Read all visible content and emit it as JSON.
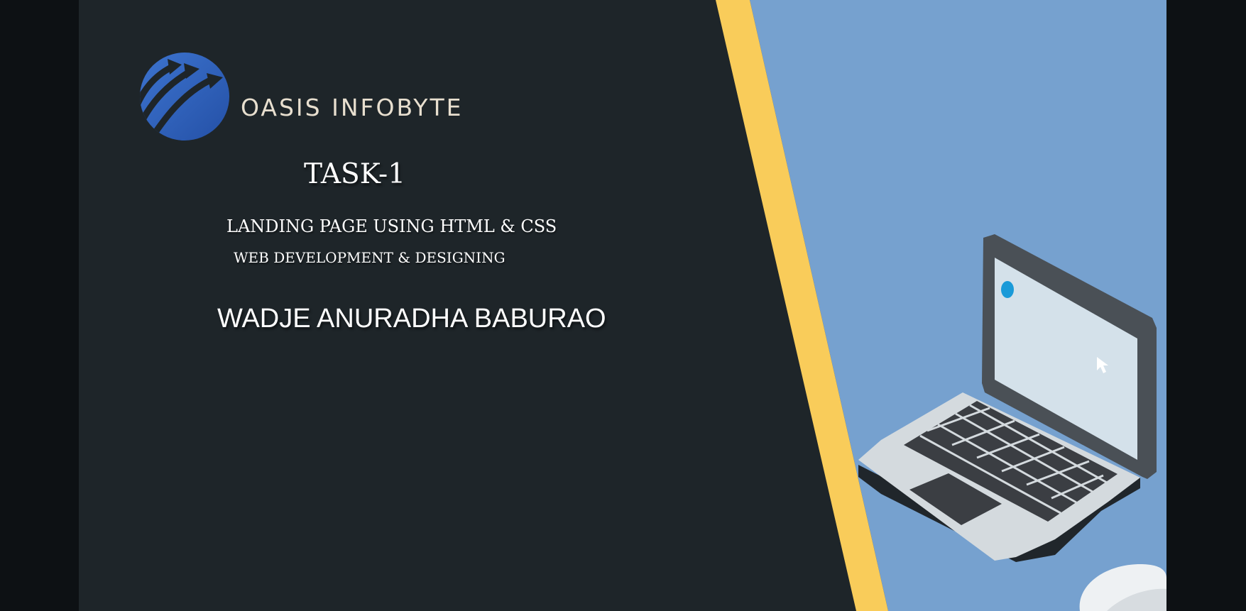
{
  "slide": {
    "brand_name": "OASIS INFOBYTE",
    "task_title": "TASK-1",
    "subtitle_1": "LANDING PAGE USING HTML & CSS",
    "subtitle_2": "WEB DEVELOPMENT & DESIGNING",
    "author": "WADJE ANURADHA BABURAO"
  },
  "icons": {
    "logo": "oasis-infobyte-logo-icon",
    "laptop": "laptop-icon",
    "cursor": "cursor-icon",
    "mouse": "mouse-icon"
  },
  "colors": {
    "outer_background": "#0d1114",
    "slide_background": "#1e2529",
    "accent_yellow": "#f9cc5a",
    "panel_blue": "#76a1cf",
    "logo_blue": "#2f5fb8",
    "brand_text": "#e8dfcf",
    "text": "#ffffff"
  }
}
